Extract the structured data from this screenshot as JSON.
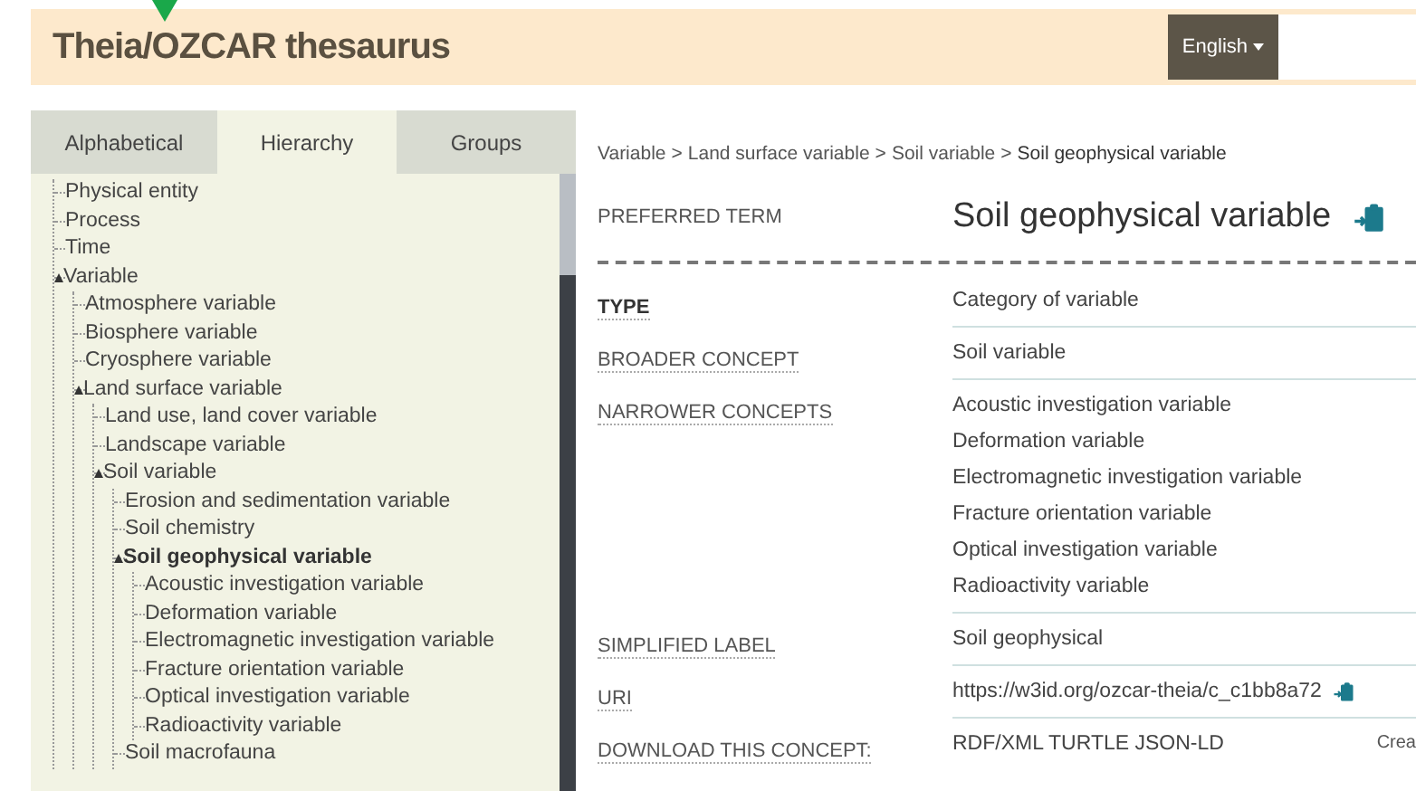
{
  "header": {
    "title": "Theia/OZCAR thesaurus",
    "language_button": "English"
  },
  "tabs": [
    {
      "label": "Alphabetical",
      "selected": false
    },
    {
      "label": "Hierarchy",
      "selected": true
    },
    {
      "label": "Groups",
      "selected": false
    }
  ],
  "tree": [
    {
      "label": "Physical entity",
      "expanded": false,
      "selected": false
    },
    {
      "label": "Process",
      "expanded": false,
      "selected": false
    },
    {
      "label": "Time",
      "expanded": false,
      "selected": false
    },
    {
      "label": "Variable",
      "expanded": true,
      "selected": false,
      "children": [
        {
          "label": "Atmosphere variable",
          "expanded": false,
          "selected": false
        },
        {
          "label": "Biosphere variable",
          "expanded": false,
          "selected": false
        },
        {
          "label": "Cryosphere variable",
          "expanded": false,
          "selected": false
        },
        {
          "label": "Land surface variable",
          "expanded": true,
          "selected": false,
          "children": [
            {
              "label": "Land use, land cover variable",
              "expanded": false,
              "selected": false
            },
            {
              "label": "Landscape variable",
              "expanded": false,
              "selected": false
            },
            {
              "label": "Soil variable",
              "expanded": true,
              "selected": false,
              "children": [
                {
                  "label": "Erosion and sedimentation variable",
                  "expanded": false,
                  "selected": false
                },
                {
                  "label": "Soil chemistry",
                  "expanded": false,
                  "selected": false
                },
                {
                  "label": "Soil geophysical variable",
                  "expanded": true,
                  "selected": true,
                  "children": [
                    {
                      "label": "Acoustic investigation variable",
                      "expanded": false,
                      "selected": false
                    },
                    {
                      "label": "Deformation variable",
                      "expanded": false,
                      "selected": false
                    },
                    {
                      "label": "Electromagnetic investigation variable",
                      "expanded": false,
                      "selected": false
                    },
                    {
                      "label": "Fracture orientation variable",
                      "expanded": false,
                      "selected": false
                    },
                    {
                      "label": "Optical investigation variable",
                      "expanded": false,
                      "selected": false
                    },
                    {
                      "label": "Radioactivity variable",
                      "expanded": false,
                      "selected": false
                    }
                  ]
                },
                {
                  "label": "Soil macrofauna",
                  "expanded": false,
                  "selected": false
                }
              ]
            }
          ]
        }
      ]
    }
  ],
  "breadcrumb": [
    "Variable",
    "Land surface variable",
    "Soil variable",
    "Soil geophysical variable"
  ],
  "breadcrumb_separator": ">",
  "preferred_term": {
    "label": "PREFERRED TERM",
    "value": "Soil geophysical variable"
  },
  "properties": [
    {
      "label": "TYPE",
      "bold": true,
      "kind": "text",
      "values": [
        "Category of variable"
      ]
    },
    {
      "label": "BROADER CONCEPT",
      "bold": false,
      "kind": "text",
      "values": [
        "Soil variable"
      ]
    },
    {
      "label": "NARROWER CONCEPTS",
      "bold": false,
      "kind": "text",
      "values": [
        "Acoustic investigation variable",
        "Deformation variable",
        "Electromagnetic investigation variable",
        "Fracture orientation variable",
        "Optical investigation variable",
        "Radioactivity variable"
      ]
    },
    {
      "label": "SIMPLIFIED LABEL",
      "bold": false,
      "kind": "text",
      "values": [
        "Soil geophysical"
      ]
    },
    {
      "label": "URI",
      "bold": false,
      "kind": "uri",
      "values": [
        "https://w3id.org/ozcar-theia/c_c1bb8a72"
      ]
    },
    {
      "label": "DOWNLOAD THIS CONCEPT:",
      "bold": false,
      "kind": "download",
      "values": [
        "RDF/XML TURTLE JSON-LD"
      ],
      "note": "Crea"
    }
  ]
}
